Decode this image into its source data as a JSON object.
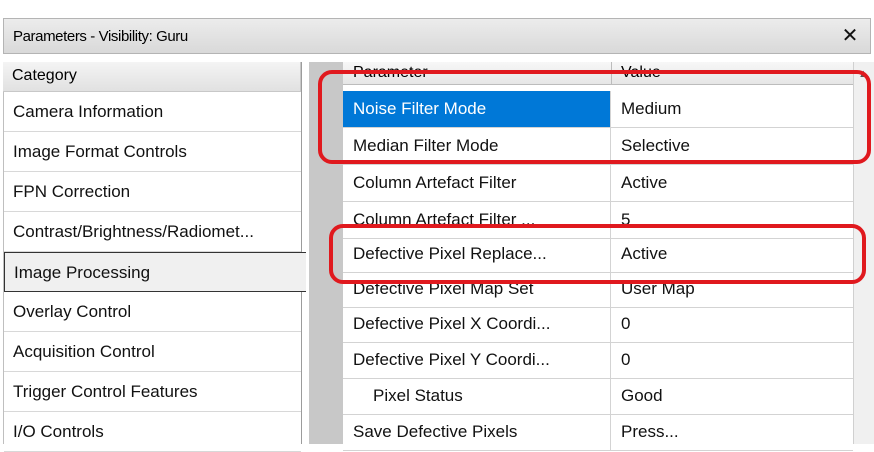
{
  "window": {
    "title": "Parameters - Visibility: Guru",
    "close_glyph": "✕"
  },
  "category_panel": {
    "header": "Category",
    "items": [
      {
        "label": "Camera Information",
        "selected": false
      },
      {
        "label": "Image Format Controls",
        "selected": false
      },
      {
        "label": "FPN Correction",
        "selected": false
      },
      {
        "label": "Contrast/Brightness/Radiomet...",
        "selected": false
      },
      {
        "label": "Image Processing",
        "selected": true
      },
      {
        "label": "Overlay Control",
        "selected": false
      },
      {
        "label": "Acquisition Control",
        "selected": false
      },
      {
        "label": "Trigger Control Features",
        "selected": false
      },
      {
        "label": "I/O Controls",
        "selected": false
      }
    ]
  },
  "parameter_grid": {
    "columns": {
      "parameter": "Parameter",
      "value": "Value"
    },
    "scroll_up_glyph": "▲",
    "rows": [
      {
        "parameter": "Noise Filter Mode",
        "value": "Medium",
        "selected": true
      },
      {
        "parameter": "Median Filter Mode",
        "value": "Selective"
      },
      {
        "parameter": "Column Artefact Filter",
        "value": "Active"
      },
      {
        "parameter": "Column Artefact Filter ...",
        "value": "5"
      },
      {
        "parameter": "Defective Pixel Replace...",
        "value": "Active"
      },
      {
        "parameter": "Defective Pixel Map Set",
        "value": "User Map"
      },
      {
        "parameter": "Defective Pixel X Coordi...",
        "value": "0"
      },
      {
        "parameter": "Defective Pixel Y Coordi...",
        "value": "0"
      },
      {
        "parameter": "Pixel Status",
        "value": "Good",
        "indent": true
      },
      {
        "parameter": "Save Defective Pixels",
        "value": "Press..."
      }
    ]
  },
  "colors": {
    "selection": "#0078d7",
    "annotation": "#e0191e"
  }
}
